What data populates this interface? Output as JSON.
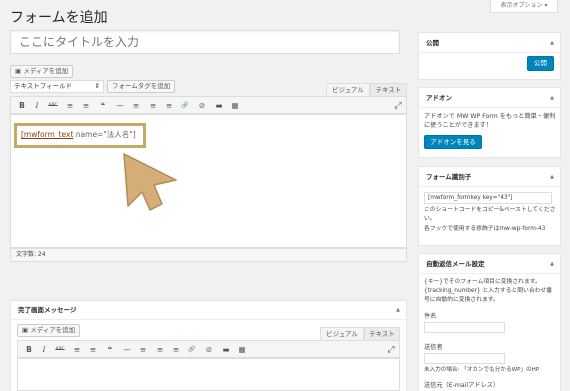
{
  "screen_options": "表示オプション ▾",
  "page_title": "フォームを追加",
  "title_placeholder": "ここにタイトルを入力",
  "editor": {
    "add_media": "メディアを追加",
    "field_select": "テキストフィールド",
    "form_tag_button": "フォームタグを追加",
    "tab_visual": "ビジュアル",
    "tab_text": "テキスト",
    "content_tag": "[mwform_text",
    "content_attr": " name=\"法人名\"]",
    "word_count": "文字数: 24"
  },
  "toolbar_icons": [
    "B",
    "I",
    "ABC",
    "≡",
    "≡",
    "❝",
    "—",
    "≡",
    "≡",
    "≡",
    "🔗",
    "⊘",
    "▬",
    "▦"
  ],
  "complete_box": {
    "title": "完了画面メッセージ",
    "add_media": "メディアを追加",
    "tab_visual": "ビジュアル",
    "tab_text": "テキスト"
  },
  "publish_box": {
    "title": "公開",
    "button": "公開"
  },
  "addon_box": {
    "title": "アドオン",
    "text": "アドオンで MW WP Form をもっと簡単・便利に使うことができます！",
    "button": "アドオンを見る"
  },
  "form_id_box": {
    "title": "フォーム識別子",
    "shortcode": "[mwform_formkey key=\"43\"]",
    "note1": "このショートコードをコピー&ペーストしてください。",
    "note2": "各フックで使用する修飾子はmw-wp-form-43"
  },
  "auto_reply_box": {
    "title": "自動返信メール設定",
    "desc": "{キー}でそのフォーム項目に変換されます。{tracking_number} と入力すると問い合わせ番号に自動的に変換されます。",
    "subject_label": "件名",
    "sender_label": "送信者",
    "sender_note": "未入力の場合: 「オカンでも分かるWP」のHP",
    "from_label": "送信元（E-mailアドレス）"
  },
  "colors": {
    "highlight": "#c8a865",
    "arrow": "#d4ad78",
    "primary": "#0085ba"
  }
}
